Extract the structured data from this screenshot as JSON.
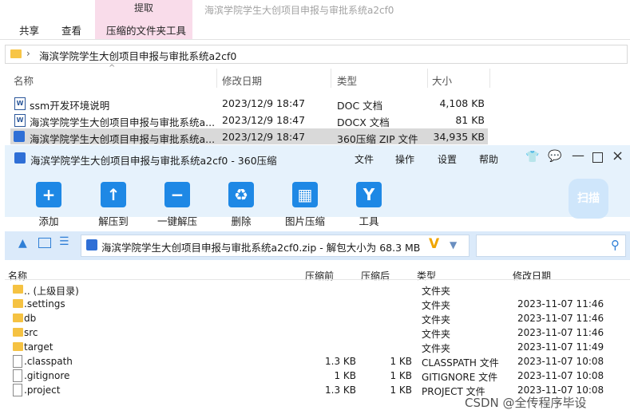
{
  "explorer": {
    "context_tab": "提取",
    "window_title": "海滨学院学生大创项目申报与审批系统a2cf0",
    "tabs": [
      "共享",
      "查看",
      "压缩的文件夹工具"
    ],
    "address": "海滨学院学生大创项目申报与审批系统a2cf0",
    "headers": {
      "name": "名称",
      "modified": "修改日期",
      "type": "类型",
      "size": "大小"
    },
    "files": [
      {
        "name": "ssm开发环境说明",
        "date": "2023/12/9 18:47",
        "type": "DOC 文档",
        "size": "4,108 KB"
      },
      {
        "name": "海滨学院学生大创项目申报与审批系统a...",
        "date": "2023/12/9 18:47",
        "type": "DOCX 文档",
        "size": "81 KB"
      },
      {
        "name": "海滨学院学生大创项目申报与审批系统a...",
        "date": "2023/12/9 18:47",
        "type": "360压缩 ZIP 文件",
        "size": "34,935 KB"
      }
    ]
  },
  "archiver": {
    "title": "海滨学院学生大创项目申报与审批系统a2cf0 - 360压缩",
    "menu": [
      "文件",
      "操作",
      "设置",
      "帮助"
    ],
    "toolbar": [
      "添加",
      "解压到",
      "一键解压",
      "删除",
      "图片压缩",
      "工具"
    ],
    "scan_label": "扫描",
    "path": "海滨学院学生大创项目申报与审批系统a2cf0.zip - 解包大小为 68.3 MB",
    "headers": {
      "name": "名称",
      "compressed": "压缩前",
      "packed": "压缩后",
      "type": "类型",
      "modified": "修改日期"
    },
    "rows": [
      {
        "name": ".. (上级目录)",
        "before": "",
        "after": "",
        "type": "文件夹",
        "date": "",
        "kind": "folder"
      },
      {
        "name": ".settings",
        "before": "",
        "after": "",
        "type": "文件夹",
        "date": "2023-11-07 11:46",
        "kind": "folder"
      },
      {
        "name": "db",
        "before": "",
        "after": "",
        "type": "文件夹",
        "date": "2023-11-07 11:46",
        "kind": "folder"
      },
      {
        "name": "src",
        "before": "",
        "after": "",
        "type": "文件夹",
        "date": "2023-11-07 11:46",
        "kind": "folder"
      },
      {
        "name": "target",
        "before": "",
        "after": "",
        "type": "文件夹",
        "date": "2023-11-07 11:49",
        "kind": "folder"
      },
      {
        "name": ".classpath",
        "before": "1.3 KB",
        "after": "1 KB",
        "type": "CLASSPATH 文件",
        "date": "2023-11-07 10:08",
        "kind": "file"
      },
      {
        "name": ".gitignore",
        "before": "1 KB",
        "after": "1 KB",
        "type": "GITIGNORE 文件",
        "date": "2023-11-07 10:08",
        "kind": "file"
      },
      {
        "name": ".project",
        "before": "1.3 KB",
        "after": "1 KB",
        "type": "PROJECT 文件",
        "date": "2023-11-07 10:08",
        "kind": "file"
      }
    ]
  },
  "watermark": "CSDN @全传程序毕设"
}
